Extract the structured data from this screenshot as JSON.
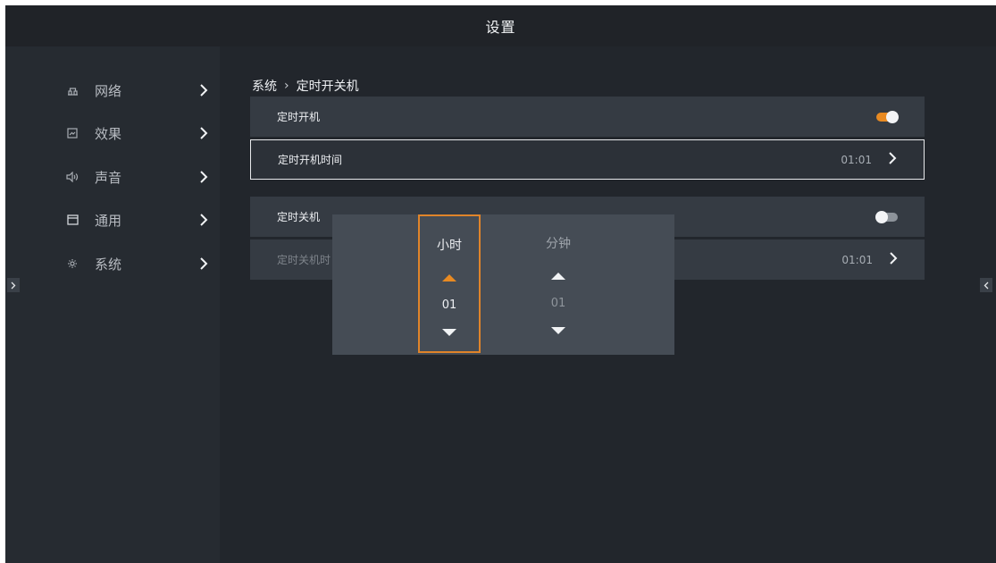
{
  "header": {
    "title": "设置"
  },
  "sidebar": {
    "items": [
      {
        "label": "网络",
        "icon": "network-icon"
      },
      {
        "label": "效果",
        "icon": "picture-effect-icon"
      },
      {
        "label": "声音",
        "icon": "speaker-icon"
      },
      {
        "label": "通用",
        "icon": "general-window-icon"
      },
      {
        "label": "系统",
        "icon": "system-gear-icon"
      }
    ]
  },
  "breadcrumb": {
    "parent": "系统",
    "separator": "›",
    "current": "定时开关机"
  },
  "rows": {
    "timer_on": {
      "label": "定时开机",
      "toggle": "on"
    },
    "timer_on_time": {
      "label": "定时开机时间",
      "value": "01:01"
    },
    "timer_off": {
      "label": "定时关机",
      "toggle": "off"
    },
    "timer_off_time": {
      "label": "定时关机时",
      "value": "01:01"
    }
  },
  "picker": {
    "hour_label": "小时",
    "hour_value": "01",
    "minute_label": "分钟",
    "minute_value": "01"
  },
  "colors": {
    "accent": "#e88a22",
    "background": "#262b31",
    "row": "#353b43",
    "picker": "#454c55"
  }
}
